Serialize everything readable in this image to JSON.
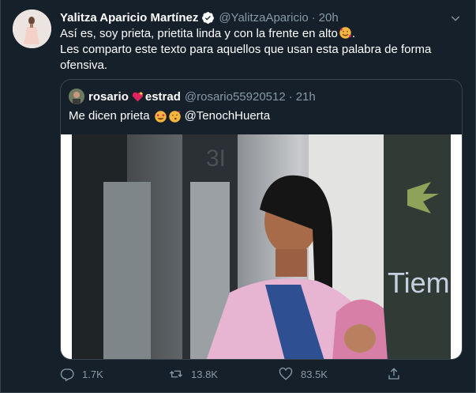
{
  "tweet": {
    "display_name": "Yalitza Aparicio Martínez",
    "handle": "@YalitzaAparicio",
    "separator": "·",
    "time": "20h",
    "line1": "Así es, soy prieta, prietita linda y con la frente en alto",
    "line1_end": ".",
    "line2": "Les comparto este texto para aquellos que usan esta palabra de forma ofensiva."
  },
  "quoted": {
    "display_name_a": "rosario",
    "display_name_b": "estrad",
    "handle": "@rosario55920512",
    "separator": "·",
    "time": "21h",
    "text": "Me dicen prieta",
    "mention": "@TenochHuerta"
  },
  "actions": {
    "reply_count": "1.7K",
    "retweet_count": "13.8K",
    "like_count": "83.5K"
  },
  "icons": {
    "verified": "verified-badge-icon",
    "caret": "chevron-down-icon",
    "reply": "reply-icon",
    "retweet": "retweet-icon",
    "like": "heart-icon",
    "share": "share-icon"
  },
  "colors": {
    "background": "#15202b",
    "border": "#38444d",
    "secondary_text": "#8899a6",
    "verified_blue": "#1da1f2"
  }
}
